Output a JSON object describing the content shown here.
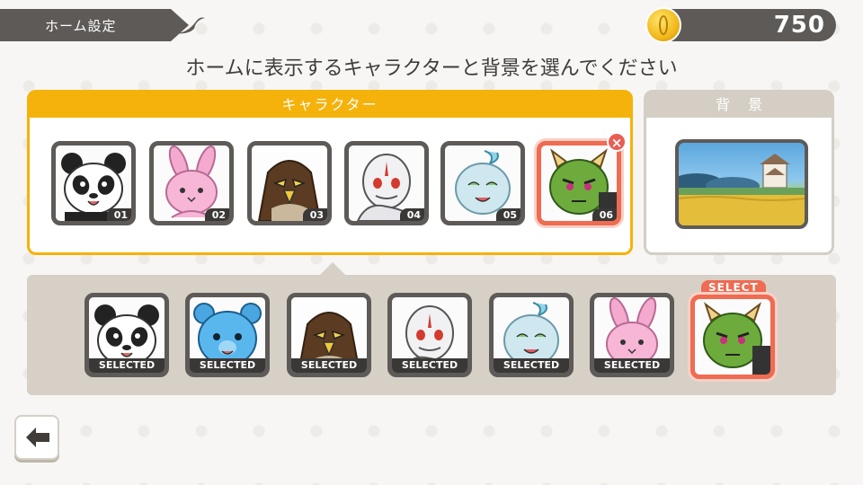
{
  "header": {
    "title": "ホーム設定",
    "coins": "750",
    "instruction": "ホームに表示するキャラクターと背景を選んでください"
  },
  "character_panel": {
    "title": "キャラクター",
    "slots": [
      {
        "number": "01",
        "character": "panda"
      },
      {
        "number": "02",
        "character": "pink-rabbit"
      },
      {
        "number": "03",
        "character": "hawk"
      },
      {
        "number": "04",
        "character": "white-snake"
      },
      {
        "number": "05",
        "character": "blue-spirit"
      },
      {
        "number": "06",
        "character": "green-oni"
      }
    ],
    "active_slot": "06"
  },
  "background_panel": {
    "title": "背景",
    "selected": "castle-field"
  },
  "character_list": [
    {
      "character": "panda",
      "status": "SELECTED"
    },
    {
      "character": "blue-bear",
      "status": "SELECTED"
    },
    {
      "character": "hawk",
      "status": "SELECTED"
    },
    {
      "character": "white-snake",
      "status": "SELECTED"
    },
    {
      "character": "blue-spirit",
      "status": "SELECTED"
    },
    {
      "character": "pink-rabbit",
      "status": "SELECTED"
    },
    {
      "character": "green-oni",
      "status": "SELECT"
    }
  ],
  "colors": {
    "accent": "#f5b20a",
    "highlight": "#ef6b52",
    "dark": "#5d5a58",
    "panel": "#d6d0c6"
  },
  "icons": {
    "back": "back-arrow-icon",
    "coin": "coin-icon",
    "remove": "close-icon"
  }
}
